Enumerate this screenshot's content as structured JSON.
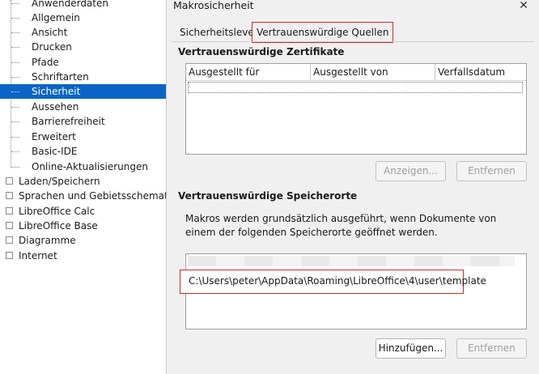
{
  "tree": {
    "children": [
      {
        "label": "Anwenderdaten",
        "selected": false
      },
      {
        "label": "Allgemein",
        "selected": false
      },
      {
        "label": "Ansicht",
        "selected": false
      },
      {
        "label": "Drucken",
        "selected": false
      },
      {
        "label": "Pfade",
        "selected": false
      },
      {
        "label": "Schriftarten",
        "selected": false
      },
      {
        "label": "Sicherheit",
        "selected": true
      },
      {
        "label": "Aussehen",
        "selected": false
      },
      {
        "label": "Barrierefreiheit",
        "selected": false
      },
      {
        "label": "Erweitert",
        "selected": false
      },
      {
        "label": "Basic-IDE",
        "selected": false
      },
      {
        "label": "Online-Aktualisierungen",
        "selected": false
      }
    ],
    "top_level": [
      {
        "label": "Laden/Speichern"
      },
      {
        "label": "Sprachen und Gebietsschemata"
      },
      {
        "label": "LibreOffice Calc"
      },
      {
        "label": "LibreOffice Base"
      },
      {
        "label": "Diagramme"
      },
      {
        "label": "Internet"
      }
    ]
  },
  "dialog": {
    "title": "Makrosicherheit",
    "close_glyph": "✕",
    "tabs": [
      {
        "label": "Sicherheitslevel",
        "active": false
      },
      {
        "label": "Vertrauenswürdige Quellen",
        "active": true
      }
    ],
    "certificates": {
      "heading": "Vertrauenswürdige Zertifikate",
      "columns": [
        "Ausgestellt für",
        "Ausgestellt von",
        "Verfallsdatum"
      ],
      "rows": [],
      "view_button": "Anzeigen...",
      "remove_button": "Entfernen"
    },
    "locations": {
      "heading": "Vertrauenswürdige Speicherorte",
      "description": "Makros werden grundsätzlich ausgeführt, wenn Dokumente von einem der folgenden Speicherorte geöffnet werden.",
      "items": [
        "C:\\Users\\peter\\AppData\\Roaming\\LibreOffice\\4\\user\\template"
      ],
      "add_button": "Hinzufügen...",
      "remove_button": "Entfernen"
    }
  },
  "colors": {
    "selection": "#0a64c8",
    "highlight_border": "#d9272e",
    "dialog_bg": "#f0f0f0"
  }
}
